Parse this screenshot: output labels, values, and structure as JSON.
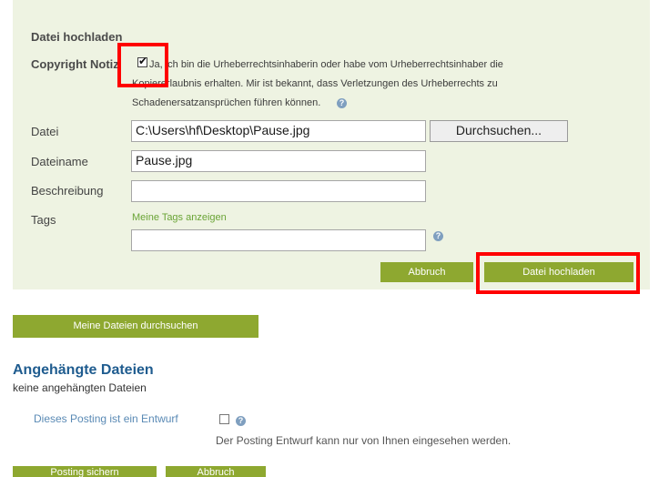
{
  "upload": {
    "heading": "Datei hochladen",
    "copyright_label": "Copyright Notiz",
    "copyright_text_1": "Ja, ich bin die Urheberrechtsinhaberin oder habe vom Urheberrechtsinhaber die",
    "copyright_text_2": "Kopiererlaubnis erhalten. Mir ist bekannt, dass Verletzungen des Urheberrechts zu",
    "copyright_text_3": "Schadenersatzansprüchen führen können.",
    "file_label": "Datei",
    "file_value": "C:\\Users\\hf\\Desktop\\Pause.jpg",
    "browse_label": "Durchsuchen...",
    "filename_label": "Dateiname",
    "filename_value": "Pause.jpg",
    "description_label": "Beschreibung",
    "description_value": "",
    "tags_label": "Tags",
    "show_tags_link": "Meine Tags anzeigen",
    "tags_value": "",
    "cancel_label": "Abbruch",
    "upload_label": "Datei hochladen"
  },
  "browse_files_label": "Meine Dateien durchsuchen",
  "attached": {
    "heading": "Angehängte Dateien",
    "empty_text": "keine angehängten Dateien"
  },
  "draft": {
    "label": "Dieses Posting ist ein Entwurf",
    "note": "Der Posting Entwurf kann nur von Ihnen eingesehen werden."
  },
  "footer": {
    "save_label": "Posting sichern",
    "cancel_label": "Abbruch"
  },
  "colors": {
    "panel_bg": "#eef3e2",
    "accent_green": "#8ea830",
    "heading_blue": "#1f5c8f",
    "highlight_red": "#ff0000"
  }
}
